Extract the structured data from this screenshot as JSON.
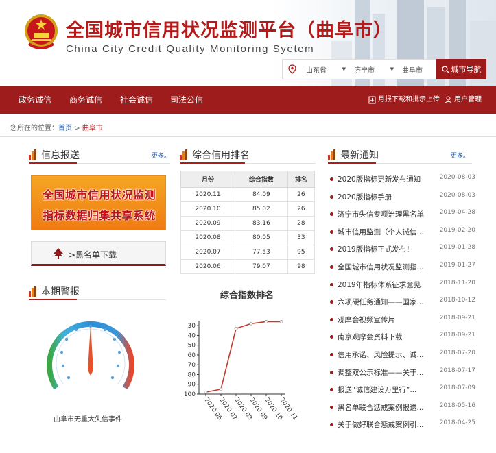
{
  "header": {
    "title_cn": "全国城市信用状况监测平台（曲阜市）",
    "title_en": "China City Credit Quality Monitoring Syetem",
    "province": "山东省",
    "city": "济宁市",
    "county": "曲阜市",
    "city_nav_label": "城市导航",
    "colors": {
      "brand_red": "#9f1c1c",
      "title_red": "#b31b1b"
    }
  },
  "nav": {
    "items": [
      "政务诚信",
      "商务诚信",
      "社会诚信",
      "司法公信"
    ],
    "monthly_report": "月报下载和批示上传",
    "user_mgmt": "用户管理"
  },
  "breadcrumb": {
    "prefix": "您所在的位置：",
    "home": "首页",
    "sep": ">",
    "current": "曲阜市"
  },
  "info": {
    "title": "信息报送",
    "more": "更多。",
    "banner_line1": "全国城市信用状况监测",
    "banner_line2": "指标数据归集共享系统",
    "blacklist_label": ">黑名单下载"
  },
  "warning": {
    "title": "本期警报",
    "gauge_label": "曲阜市无重大失信事件",
    "gauge_value": 0
  },
  "ranking": {
    "title": "综合信用排名",
    "headers": [
      "月份",
      "综合指数",
      "排名"
    ],
    "rows": [
      [
        "2020.11",
        "84.09",
        "26"
      ],
      [
        "2020.10",
        "85.02",
        "26"
      ],
      [
        "2020.09",
        "83.16",
        "28"
      ],
      [
        "2020.08",
        "80.05",
        "33"
      ],
      [
        "2020.07",
        "77.53",
        "95"
      ],
      [
        "2020.06",
        "79.07",
        "98"
      ]
    ]
  },
  "chart_data": {
    "type": "line",
    "title": "综合指数排名",
    "x": [
      "2020.06",
      "2020.07",
      "2020.08",
      "2020.09",
      "2020.10",
      "2020.11"
    ],
    "series": [
      {
        "values": [
          98,
          95,
          33,
          28,
          26,
          26
        ]
      }
    ],
    "yticks": [
      30,
      40,
      50,
      60,
      70,
      80,
      90,
      100
    ],
    "ylim": [
      100,
      25
    ],
    "y_inverted": true,
    "grid": false,
    "color": "#c0392b"
  },
  "news": {
    "title": "最新通知",
    "more": "更多。",
    "items": [
      {
        "title": "2020版指标更新发布通知",
        "date": "2020-08-03"
      },
      {
        "title": "2020版指标手册",
        "date": "2020-08-03"
      },
      {
        "title": "济宁市失信专项治理黑名单",
        "date": "2019-04-28"
      },
      {
        "title": "城市信用监测（个人诚信...",
        "date": "2019-02-20"
      },
      {
        "title": "2019版指标正式发布！",
        "date": "2019-01-28"
      },
      {
        "title": "全国城市信用状况监测指...",
        "date": "2019-01-27"
      },
      {
        "title": "2019年指标体系征求意见",
        "date": "2018-11-20"
      },
      {
        "title": "六项硬任务通知——国家...",
        "date": "2018-10-12"
      },
      {
        "title": "观摩会视频宣传片",
        "date": "2018-09-21"
      },
      {
        "title": "南京观摩会资料下载",
        "date": "2018-09-21"
      },
      {
        "title": "信用承诺、风险提示、诚...",
        "date": "2018-07-20"
      },
      {
        "title": "调整双公示标准——关于...",
        "date": "2018-07-17"
      },
      {
        "title": "报送“诚信建设万里行”...",
        "date": "2018-07-09"
      },
      {
        "title": "黑名单联合惩戒案例报送...",
        "date": "2018-05-16"
      },
      {
        "title": "关于做好联合惩戒案例引...",
        "date": "2018-04-25"
      }
    ]
  }
}
